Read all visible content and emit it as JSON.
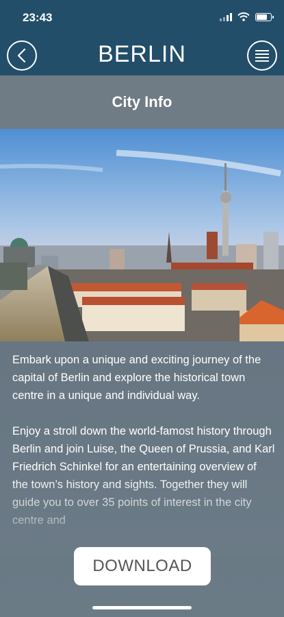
{
  "status_bar": {
    "time": "23:43"
  },
  "nav": {
    "title": "BERLIN"
  },
  "section": {
    "title": "City Info"
  },
  "content": {
    "paragraphs": [
      "Embark upon a unique and exciting journey of the capital of Berlin and explore the historical town centre in a unique and individual way.",
      "Enjoy a stroll down the world-famost history through Berlin and join Luise, the Queen of Prussia, and Karl Friedrich Schinkel for an entertaining overview of the town’s history and sights. Together they will guide you to over 35 points of interest in the city centre and"
    ]
  },
  "actions": {
    "download_label": "DOWNLOAD"
  },
  "icons": {
    "back": "chevron-left-icon",
    "menu": "menu-lines-icon",
    "signal": "cellular-signal-icon",
    "wifi": "wifi-icon",
    "battery": "battery-icon"
  },
  "colors": {
    "header_bg": "#234e69",
    "body_bg": "#6d7d88",
    "button_bg": "#ffffff"
  }
}
